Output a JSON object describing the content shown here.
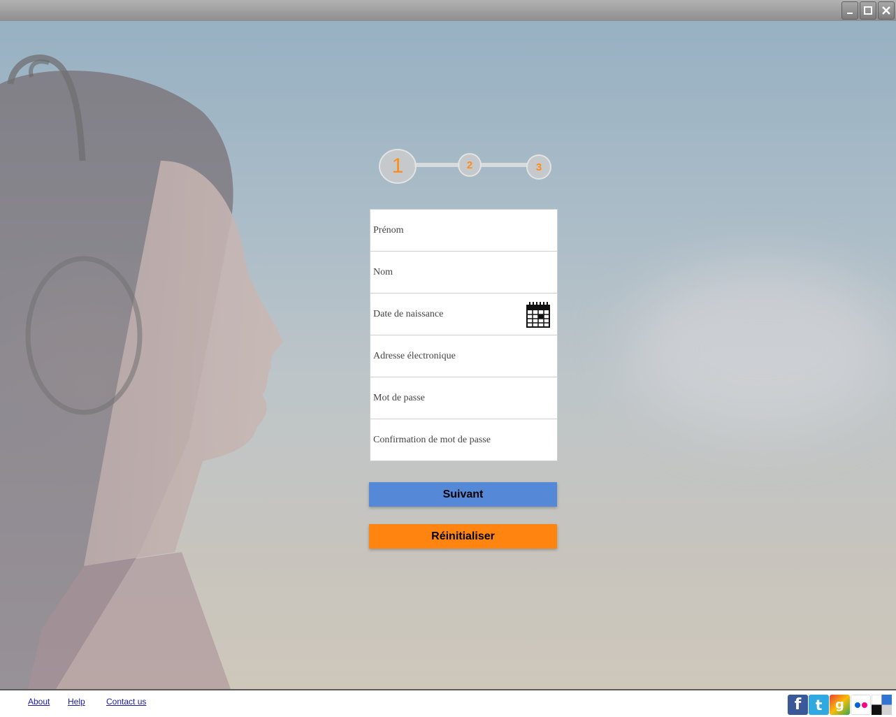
{
  "window": {
    "controls": [
      "minimize-icon",
      "maximize-icon",
      "close-icon"
    ]
  },
  "steps": [
    "1",
    "2",
    "3"
  ],
  "form": {
    "firstname_placeholder": "Prénom",
    "lastname_placeholder": "Nom",
    "birthdate_placeholder": "Date de naissance",
    "email_placeholder": "Adresse électronique",
    "password_placeholder": "Mot de passe",
    "confirm_placeholder": "Confirmation de mot de passe"
  },
  "buttons": {
    "next": "Suivant",
    "reset": "Réinitialiser"
  },
  "footer": {
    "about": "About",
    "help": "Help",
    "contact": "Contact us"
  },
  "social": [
    "facebook-icon",
    "twitter-icon",
    "google-icon",
    "flickr-icon",
    "delicious-icon"
  ],
  "colors": {
    "accent_orange": "#ff8510",
    "button_blue": "#5589d8",
    "step_number": "#ff8c1a"
  }
}
